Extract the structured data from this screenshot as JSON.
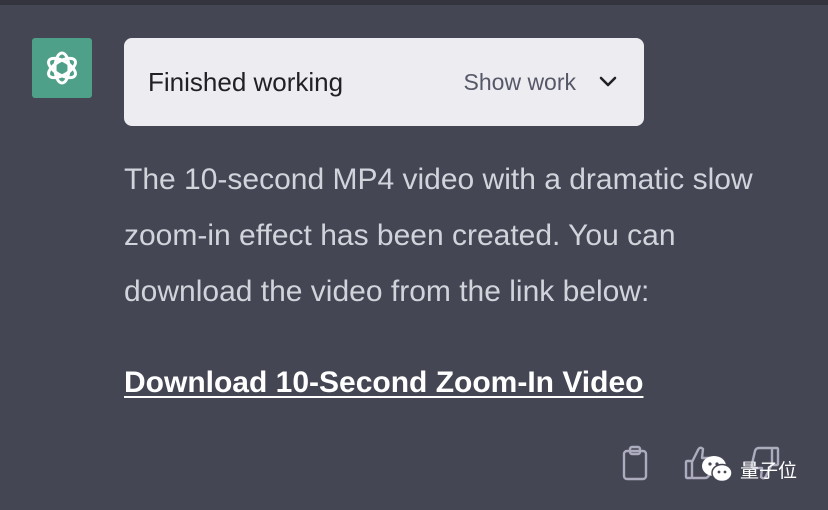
{
  "assistant": {
    "avatar_icon": "openai-logo-icon",
    "avatar_color": "#4fa088"
  },
  "tool_card": {
    "status": "Finished working",
    "toggle_label": "Show work",
    "toggle_icon": "chevron-down-icon"
  },
  "message": {
    "text": "The 10-second MP4 video with a dramatic slow zoom-in effect has been created. You can download the video from the link below:",
    "link_text": "Download 10-Second Zoom-In Video"
  },
  "actions": {
    "copy_icon": "clipboard-icon",
    "like_icon": "thumbs-up-icon",
    "dislike_icon": "thumbs-down-icon"
  },
  "watermark": {
    "text": "量子位",
    "icon": "wechat-icon"
  }
}
